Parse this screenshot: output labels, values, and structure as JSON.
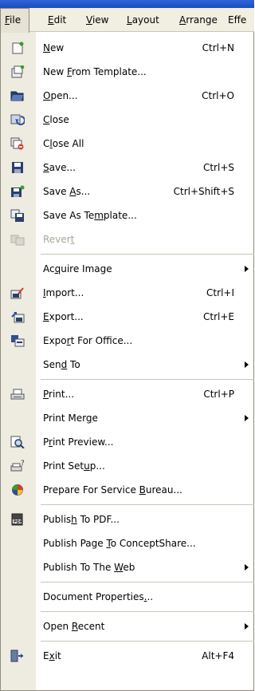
{
  "menubar": [
    {
      "key": "file",
      "parts": [
        "",
        "F",
        "ile"
      ],
      "active": true
    },
    {
      "key": "edit",
      "parts": [
        "",
        "E",
        "dit"
      ]
    },
    {
      "key": "view",
      "parts": [
        "",
        "V",
        "iew"
      ]
    },
    {
      "key": "layout",
      "parts": [
        "",
        "L",
        "ayout"
      ]
    },
    {
      "key": "arrange",
      "parts": [
        "",
        "A",
        "rrange"
      ]
    },
    {
      "key": "effects",
      "parts": [
        "",
        "",
        "Effe"
      ]
    }
  ],
  "file_menu": {
    "items": [
      {
        "key": "new",
        "pre": "",
        "acc": "N",
        "post": "ew",
        "shortcut": "Ctrl+N",
        "icon": "new-document-icon"
      },
      {
        "key": "new-from-template",
        "pre": "New ",
        "acc": "F",
        "post": "rom Template...",
        "shortcut": "",
        "icon": "new-from-template-icon"
      },
      {
        "key": "open",
        "pre": "",
        "acc": "O",
        "post": "pen...",
        "shortcut": "Ctrl+O",
        "icon": "open-folder-icon"
      },
      {
        "key": "close",
        "pre": "",
        "acc": "C",
        "post": "lose",
        "shortcut": "",
        "icon": "close-document-icon"
      },
      {
        "key": "close-all",
        "pre": "C",
        "acc": "l",
        "post": "ose All",
        "shortcut": "",
        "icon": "close-all-icon"
      },
      {
        "key": "save",
        "pre": "",
        "acc": "S",
        "post": "ave...",
        "shortcut": "Ctrl+S",
        "icon": "save-disk-icon"
      },
      {
        "key": "save-as",
        "pre": "Save ",
        "acc": "A",
        "post": "s...",
        "shortcut": "Ctrl+Shift+S",
        "icon": "save-as-icon"
      },
      {
        "key": "save-as-template",
        "pre": "Save As Te",
        "acc": "m",
        "post": "plate...",
        "shortcut": "",
        "icon": "save-as-template-icon"
      },
      {
        "key": "revert",
        "pre": "Rever",
        "acc": "t",
        "post": "",
        "shortcut": "",
        "icon": "revert-icon",
        "disabled": true
      },
      {
        "sep": true
      },
      {
        "key": "acquire-image",
        "pre": "Ac",
        "acc": "q",
        "post": "uire Image",
        "shortcut": "",
        "submenu": true
      },
      {
        "key": "import",
        "pre": "",
        "acc": "I",
        "post": "mport...",
        "shortcut": "Ctrl+I",
        "icon": "import-icon"
      },
      {
        "key": "export",
        "pre": "",
        "acc": "E",
        "post": "xport...",
        "shortcut": "Ctrl+E",
        "icon": "export-icon"
      },
      {
        "key": "export-for-office",
        "pre": "Expo",
        "acc": "r",
        "post": "t For Office...",
        "shortcut": "",
        "icon": "export-for-office-icon"
      },
      {
        "key": "send-to",
        "pre": "Sen",
        "acc": "d",
        "post": " To",
        "shortcut": "",
        "submenu": true
      },
      {
        "sep": true
      },
      {
        "key": "print",
        "pre": "",
        "acc": "P",
        "post": "rint...",
        "shortcut": "Ctrl+P",
        "icon": "printer-icon"
      },
      {
        "key": "print-merge",
        "pre": "Print Mer",
        "acc": "g",
        "post": "e",
        "shortcut": "",
        "submenu": true
      },
      {
        "key": "print-preview",
        "pre": "P",
        "acc": "r",
        "post": "int Preview...",
        "shortcut": "",
        "icon": "print-preview-icon"
      },
      {
        "key": "print-setup",
        "pre": "Print Set",
        "acc": "u",
        "post": "p...",
        "shortcut": "",
        "icon": "print-setup-icon"
      },
      {
        "key": "prepare-for-service-bureau",
        "pre": "Prepare For Service ",
        "acc": "B",
        "post": "ureau...",
        "shortcut": "",
        "icon": "service-bureau-icon"
      },
      {
        "sep": true
      },
      {
        "key": "publish-to-pdf",
        "pre": "Publis",
        "acc": "h",
        "post": " To PDF...",
        "shortcut": "",
        "icon": "pdf-icon"
      },
      {
        "key": "publish-page-to-conceptshare",
        "pre": "Publish Page ",
        "acc": "T",
        "post": "o ConceptShare...",
        "shortcut": ""
      },
      {
        "key": "publish-to-the-web",
        "pre": "Publish To The ",
        "acc": "W",
        "post": "eb",
        "shortcut": "",
        "submenu": true
      },
      {
        "sep": true
      },
      {
        "key": "document-properties",
        "pre": "Document Properties",
        "acc": ".",
        "post": "..",
        "shortcut": ""
      },
      {
        "sep": true
      },
      {
        "key": "open-recent",
        "pre": "Open ",
        "acc": "R",
        "post": "ecent",
        "shortcut": "",
        "submenu": true
      },
      {
        "sep": true
      },
      {
        "key": "exit",
        "pre": "E",
        "acc": "x",
        "post": "it",
        "shortcut": "Alt+F4",
        "icon": "exit-icon"
      }
    ]
  }
}
